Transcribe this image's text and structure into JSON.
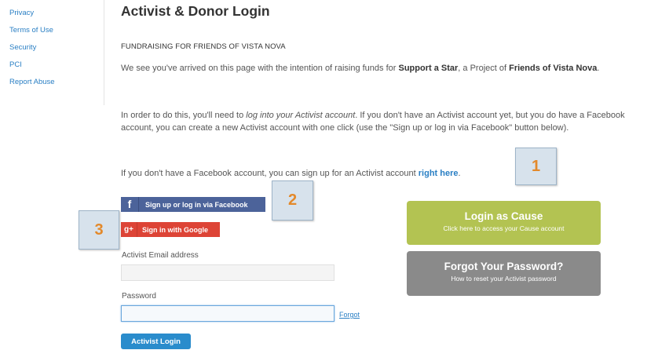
{
  "sidebar": {
    "items": [
      {
        "label": "Privacy"
      },
      {
        "label": "Terms of Use"
      },
      {
        "label": "Security"
      },
      {
        "label": "PCI"
      },
      {
        "label": "Report Abuse"
      }
    ]
  },
  "page": {
    "title": "Activist & Donor Login",
    "subhead": "FUNDRAISING FOR FRIENDS OF VISTA NOVA"
  },
  "intro": {
    "text_before": "We see you've arrived on this page with the intention of raising funds for ",
    "project": "Support a Star",
    "text_middle": ", a Project of ",
    "org": "Friends of Vista Nova",
    "text_after": "."
  },
  "instructions": {
    "text_before": "In order to do this, you'll need to ",
    "emphasis": "log into your Activist account",
    "text_after": ". If you don't have an Activist account yet, but you do have a Facebook account, you can create a new Activist account with one click (use the \"Sign up or log in via Facebook\" button below)."
  },
  "signup_line": {
    "text_before": "If you don't have a Facebook account, you can sign up for an Activist account ",
    "link": "right here",
    "text_after": "."
  },
  "facebook_button": {
    "icon": "f",
    "label": "Sign up or log in via Facebook",
    "color": "#4c639a"
  },
  "google_button": {
    "icon": "g+",
    "label": "Sign in with Google",
    "color": "#dd4436"
  },
  "email_field": {
    "label": "Activist Email address",
    "value": ""
  },
  "password_field": {
    "label": "Password",
    "value": ""
  },
  "forgot_link": "Forgot",
  "login_button": "Activist Login",
  "cause_button": {
    "title": "Login as Cause",
    "subtitle": "Click here to access your Cause account",
    "color": "#b3c352"
  },
  "password_button": {
    "title": "Forgot Your Password?",
    "subtitle": "How to reset your Activist password",
    "color": "#8a8a8a"
  },
  "callouts": [
    "1",
    "2",
    "3"
  ],
  "colors": {
    "link": "#2a7fc4",
    "primary": "#2a8ccc",
    "callout_number": "#e3892b"
  }
}
